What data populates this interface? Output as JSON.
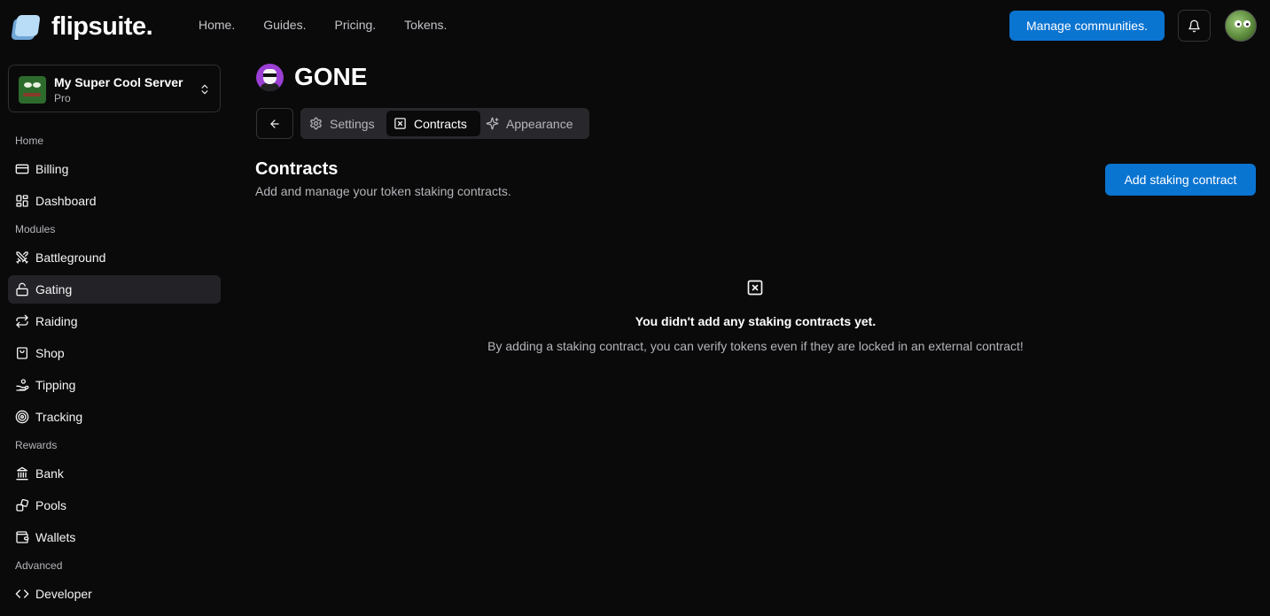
{
  "app": {
    "logo_text": "flipsuite."
  },
  "topnav": {
    "items": [
      "Home.",
      "Guides.",
      "Pricing.",
      "Tokens."
    ]
  },
  "header": {
    "manage_label": "Manage communities."
  },
  "server": {
    "name": "My Super Cool Server",
    "plan": "Pro"
  },
  "sidebar": {
    "sections": {
      "home": "Home",
      "modules": "Modules",
      "rewards": "Rewards",
      "advanced": "Advanced"
    },
    "items": {
      "billing": "Billing",
      "dashboard": "Dashboard",
      "battleground": "Battleground",
      "gating": "Gating",
      "raiding": "Raiding",
      "shop": "Shop",
      "tipping": "Tipping",
      "tracking": "Tracking",
      "bank": "Bank",
      "pools": "Pools",
      "wallets": "Wallets",
      "developer": "Developer"
    },
    "active": "Gating"
  },
  "project": {
    "title": "GONE"
  },
  "tabs": {
    "settings": "Settings",
    "contracts": "Contracts",
    "appearance": "Appearance",
    "active": "Contracts"
  },
  "contracts": {
    "title": "Contracts",
    "subtitle": "Add and manage your token staking contracts.",
    "add_label": "Add staking contract",
    "empty_title": "You didn't add any staking contracts yet.",
    "empty_desc": "By adding a staking contract, you can verify tokens even if they are locked in an external contract!"
  },
  "icons": {
    "logo": "flipsuite-logo-icon",
    "bell": "bell-icon",
    "server_switch": "chevrons-up-down-icon",
    "back": "arrow-left-icon",
    "settings": "gear-icon",
    "contracts": "square-x-icon",
    "appearance": "sparkles-icon"
  },
  "colors": {
    "primary": "#0a74d1",
    "background": "#0a0a0b",
    "active_item": "#232327"
  }
}
